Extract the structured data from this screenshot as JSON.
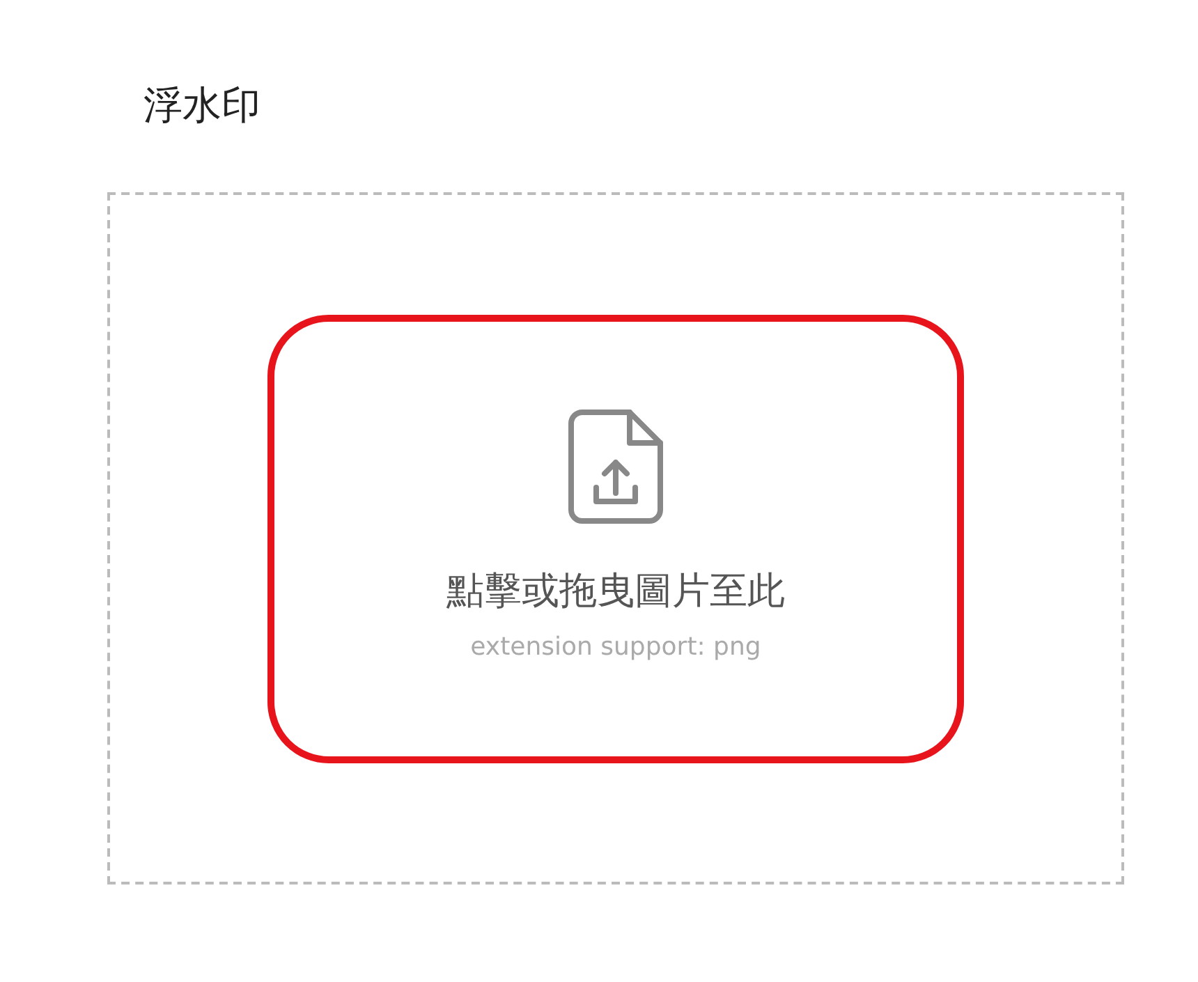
{
  "title": "浮水印",
  "dropzone": {
    "highlighted": true,
    "label": "點擊或拖曳圖片至此",
    "hint": "extension support: png"
  }
}
